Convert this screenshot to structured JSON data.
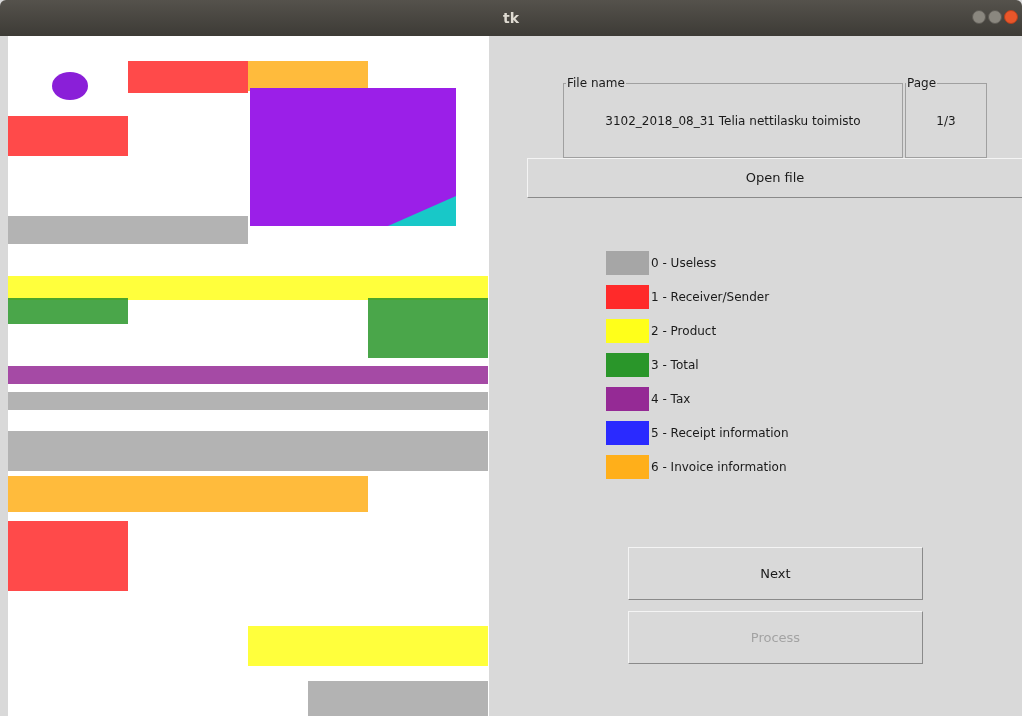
{
  "window": {
    "title": "tk"
  },
  "file_name": {
    "label": "File name",
    "value": "3102_2018_08_31 Telia nettilasku toimisto"
  },
  "page": {
    "label": "Page",
    "value": "1/3"
  },
  "open_button": {
    "label": "Open file",
    "disabled": false
  },
  "legend": [
    {
      "label": "0 - Useless",
      "color": "#a6a6a6"
    },
    {
      "label": "1 - Receiver/Sender",
      "color": "#ff2a2a"
    },
    {
      "label": "2 - Product",
      "color": "#ffff1a"
    },
    {
      "label": "3 - Total",
      "color": "#2a962a"
    },
    {
      "label": "4 - Tax",
      "color": "#952a95"
    },
    {
      "label": "5 - Receipt information",
      "color": "#2a2aff"
    },
    {
      "label": "6 - Invoice information",
      "color": "#ffaf1a"
    }
  ],
  "actions": [
    {
      "label": "Next",
      "disabled": false
    },
    {
      "label": "Process",
      "disabled": true
    }
  ]
}
